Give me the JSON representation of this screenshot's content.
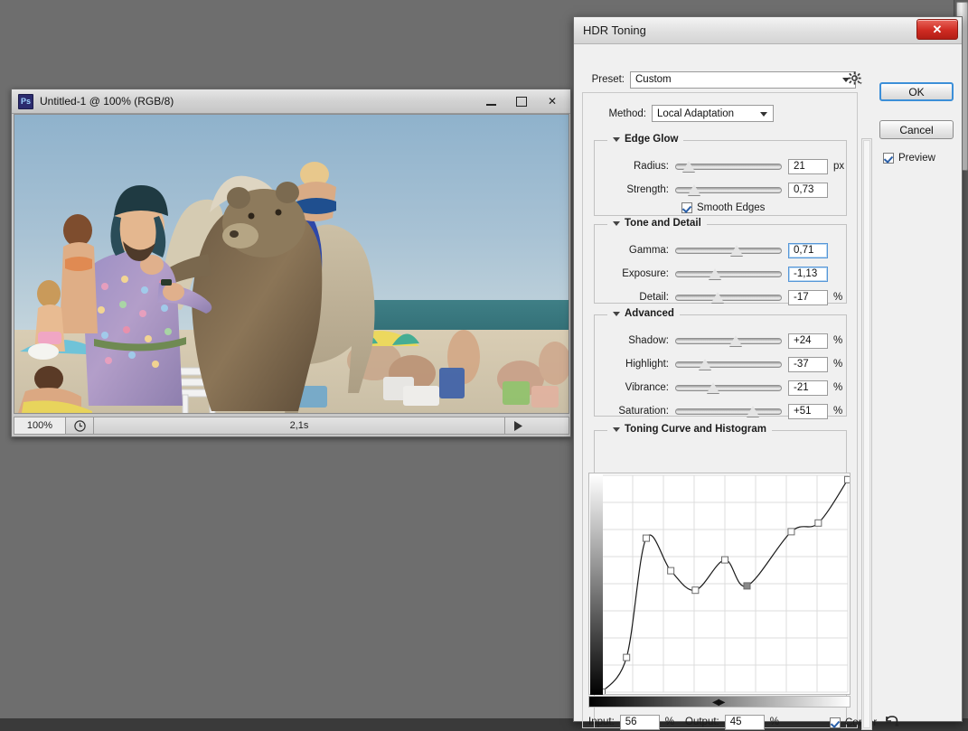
{
  "app": {
    "background_color": "#6e6e6e"
  },
  "document_window": {
    "title": "Untitled-1 @ 100% (RGB/8)",
    "app_icon": "photoshop-icon",
    "app_icon_text": "Ps",
    "window_buttons": [
      "minimize",
      "maximize",
      "close"
    ],
    "close_glyph": "✕",
    "status_bar": {
      "zoom": "100%",
      "clock_icon": "clock-icon",
      "time": "2,1s",
      "play_icon": "play-triangle-icon"
    },
    "photo_description": "Beach scene: man in floral coat with a brown bear and a camel"
  },
  "dialog": {
    "title": "HDR Toning",
    "close_glyph": "✕",
    "preset": {
      "label": "Preset:",
      "value": "Custom",
      "gear_icon": "gear-icon"
    },
    "method": {
      "label": "Method:",
      "value": "Local Adaptation"
    },
    "buttons": {
      "ok": "OK",
      "cancel": "Cancel"
    },
    "preview": {
      "label": "Preview",
      "checked": true
    },
    "groups": [
      {
        "id": "edge-glow",
        "title": "Edge Glow",
        "sliders": [
          {
            "name": "Radius:",
            "value": "21",
            "unit": "px",
            "pos": 0.12,
            "focused": false
          },
          {
            "name": "Strength:",
            "value": "0,73",
            "unit": "",
            "pos": 0.17,
            "focused": false
          }
        ],
        "checkbox": {
          "label": "Smooth Edges",
          "checked": true
        }
      },
      {
        "id": "tone-and-detail",
        "title": "Tone and Detail",
        "sliders": [
          {
            "name": "Gamma:",
            "value": "0,71",
            "unit": "",
            "pos": 0.58,
            "focused": true
          },
          {
            "name": "Exposure:",
            "value": "-1,13",
            "unit": "",
            "pos": 0.37,
            "focused": true
          },
          {
            "name": "Detail:",
            "value": "-17",
            "unit": "%",
            "pos": 0.4,
            "focused": false
          }
        ]
      },
      {
        "id": "advanced",
        "title": "Advanced",
        "sliders": [
          {
            "name": "Shadow:",
            "value": "+24",
            "unit": "%",
            "pos": 0.57,
            "focused": false
          },
          {
            "name": "Highlight:",
            "value": "-37",
            "unit": "%",
            "pos": 0.28,
            "focused": false
          },
          {
            "name": "Vibrance:",
            "value": "-21",
            "unit": "%",
            "pos": 0.35,
            "focused": false
          },
          {
            "name": "Saturation:",
            "value": "+51",
            "unit": "%",
            "pos": 0.73,
            "focused": false
          }
        ]
      }
    ],
    "curve_panel": {
      "title": "Toning Curve and Histogram",
      "input": {
        "label": "Input:",
        "value": "56",
        "unit": "%"
      },
      "output": {
        "label": "Output:",
        "value": "45",
        "unit": "%"
      },
      "corner": {
        "label": "Corner",
        "checked": true
      },
      "reset_icon": "reset-arrow-icon",
      "gradient_handles": "◀▶"
    }
  },
  "chart_data": {
    "type": "line",
    "title": "Toning Curve and Histogram",
    "xlabel": "Input",
    "ylabel": "Output",
    "xlim": [
      0,
      100
    ],
    "ylim": [
      0,
      100
    ],
    "grid": true,
    "grid_divisions": 8,
    "points": [
      {
        "x": 0,
        "y": 0
      },
      {
        "x": 10,
        "y": 16
      },
      {
        "x": 18,
        "y": 71
      },
      {
        "x": 28,
        "y": 56
      },
      {
        "x": 38,
        "y": 47
      },
      {
        "x": 50,
        "y": 61
      },
      {
        "x": 59,
        "y": 49
      },
      {
        "x": 77,
        "y": 74
      },
      {
        "x": 88,
        "y": 78
      },
      {
        "x": 100,
        "y": 98
      }
    ],
    "selected_point": {
      "x": 59,
      "y": 49
    }
  }
}
